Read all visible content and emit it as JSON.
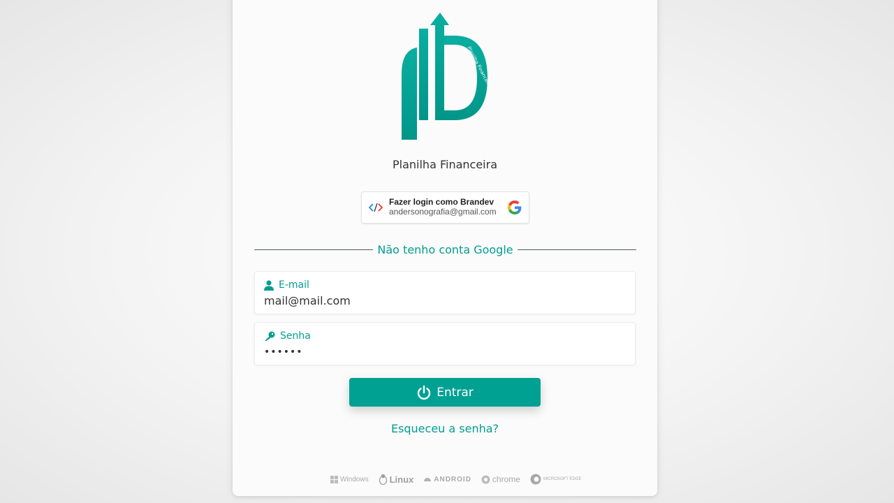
{
  "app": {
    "title": "Planilha Financeira",
    "logo_ring_text": "Planilha Financeira"
  },
  "google_login": {
    "title": "Fazer login como Brandev",
    "email": "andersonografia@gmail.com"
  },
  "divider": {
    "label": "Não tenho conta Google"
  },
  "form": {
    "email": {
      "label": "E-mail",
      "value": "mail@mail.com",
      "icon": "user-icon"
    },
    "password": {
      "label": "Senha",
      "value": "••••••",
      "icon": "key-icon"
    },
    "submit_label": "Entrar",
    "forgot_label": "Esqueceu a senha?"
  },
  "platforms": [
    {
      "name": "Windows",
      "icon": "windows-icon"
    },
    {
      "name": "Linux",
      "icon": "linux-icon"
    },
    {
      "name": "ANDROID",
      "icon": "android-icon"
    },
    {
      "name": "chrome",
      "icon": "chrome-icon"
    },
    {
      "name": "MICROSOFT EDGE",
      "icon": "edge-icon"
    }
  ],
  "colors": {
    "accent": "#00a193",
    "accent_text": "#009e8f",
    "background": "#f3f3f3",
    "card": "#fbfbfb"
  }
}
